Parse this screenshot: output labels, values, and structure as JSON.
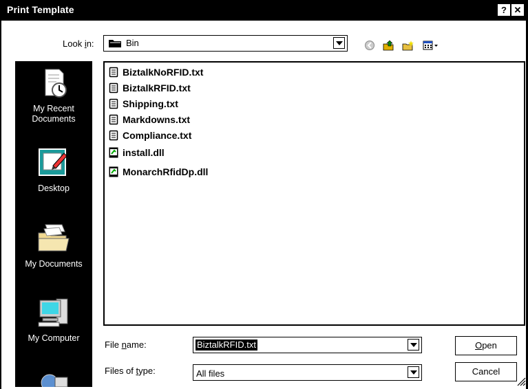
{
  "window": {
    "title": "Print Template",
    "help_glyph": "?",
    "close_glyph": "✕"
  },
  "lookin": {
    "label_pre": "Look ",
    "label_acc": "i",
    "label_post": "n:",
    "value": "Bin"
  },
  "toolbar": {
    "icons": [
      "back-icon",
      "up-folder-icon",
      "new-folder-icon",
      "views-menu-icon"
    ]
  },
  "places": [
    {
      "label": "My Recent\nDocuments",
      "icon": "recent-documents-icon"
    },
    {
      "label": "Desktop",
      "icon": "desktop-icon"
    },
    {
      "label": "My Documents",
      "icon": "my-documents-icon"
    },
    {
      "label": "My Computer",
      "icon": "my-computer-icon"
    }
  ],
  "files": [
    {
      "name": "BiztalkNoRFID.txt",
      "type": "txt"
    },
    {
      "name": "BiztalkRFID.txt",
      "type": "txt"
    },
    {
      "name": "Shipping.txt",
      "type": "txt"
    },
    {
      "name": "Markdowns.txt",
      "type": "txt"
    },
    {
      "name": "Compliance.txt",
      "type": "txt"
    },
    {
      "name": "install.dll",
      "type": "dll"
    },
    {
      "name": "MonarchRfidDp.dll",
      "type": "dll"
    }
  ],
  "filename": {
    "label_pre": "File ",
    "label_acc": "n",
    "label_post": "ame:",
    "value": "BiztalkRFID.txt"
  },
  "filetype": {
    "label_pre": "Files of ",
    "label_acc": "t",
    "label_post": "ype:",
    "value": "All files"
  },
  "buttons": {
    "open_acc": "O",
    "open_rest": "pen",
    "cancel": "Cancel"
  }
}
